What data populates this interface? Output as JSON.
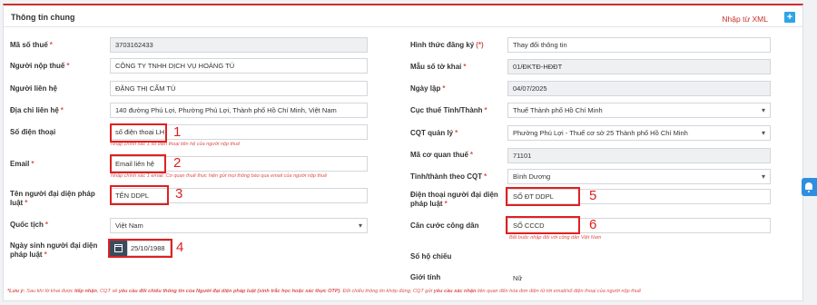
{
  "panel": {
    "title": "Thông tin chung",
    "import_label": "Nhập từ XML",
    "import_icon": "+"
  },
  "left": {
    "tax_code": {
      "label": "Mã số thuế",
      "value": "3703162433"
    },
    "taxpayer": {
      "label": "Người nộp thuế",
      "value": "CÔNG TY TNHH DỊCH VỤ HOÀNG TÚ"
    },
    "contact_person": {
      "label": "Người liên hệ",
      "value": "ĐẶNG THỊ CẨM TÚ"
    },
    "contact_address": {
      "label": "Địa chỉ liên hệ",
      "value": "140 đường Phú Lợi, Phường Phú Lợi, Thành phố Hồ Chí Minh, Việt Nam"
    },
    "phone": {
      "label": "Số điện thoại",
      "value": "số điện thoại LH",
      "hint": "Nhập chính xác 1 số điện thoại liên hệ của người nộp thuế",
      "marker": "1"
    },
    "email": {
      "label": "Email",
      "value": "Email liên hệ",
      "hint": "Nhập chính xác 1 email. Cơ quan thuế thực hiện gửi mọi thông báo qua email của người nộp thuế",
      "marker": "2"
    },
    "legal_rep": {
      "label_line1": "Tên người đại diện pháp",
      "label_line2": "luật",
      "value": "TÊN DDPL",
      "marker": "3"
    },
    "nationality": {
      "label": "Quốc tịch",
      "value": "Việt Nam"
    },
    "birthdate": {
      "label_line1": "Ngày sinh người đại diện",
      "label_line2": "pháp luật",
      "value": "25/10/1988",
      "marker": "4"
    }
  },
  "right": {
    "reg_form": {
      "label": "Hình thức đăng ký",
      "value": "Thay đổi thông tin"
    },
    "declaration_form": {
      "label": "Mẫu số tờ khai",
      "value": "01/ĐKTĐ-HĐĐT"
    },
    "created_date": {
      "label": "Ngày lập",
      "value": "04/07/2025"
    },
    "tax_department": {
      "label": "Cục thuế Tỉnh/Thành",
      "value": "Thuế Thành phố Hồ Chí Minh"
    },
    "managing_authority": {
      "label": "CQT quản lý",
      "value": "Phường Phú Lợi - Thuế cơ sở 25 Thành phố Hồ Chí Minh"
    },
    "authority_code": {
      "label": "Mã cơ quan thuế",
      "value": "71101"
    },
    "province": {
      "label": "Tỉnh/thành theo CQT",
      "value": "Bình Dương"
    },
    "rep_phone": {
      "label_line1": "Điện thoại người đại diện",
      "label_line2": "pháp luật",
      "value": "SỐ ĐT DDPL",
      "marker": "5"
    },
    "id_card": {
      "label": "Căn cước công dân",
      "value": "SỐ CCCD",
      "hint": "Bắt buộc nhập đối với công dân Việt Nam",
      "marker": "6"
    },
    "passport": {
      "label": "Số hộ chiếu",
      "value": ""
    },
    "gender": {
      "label": "Giới tính",
      "value": "Nữ"
    }
  },
  "note": {
    "prefix": "*Lưu ý:",
    "text1": " Sau khi tờ khai được ",
    "bold1": "tiếp nhận",
    "text2": ", CQT sẽ ",
    "bold2": "yêu cầu đổi chiếu thông tin của Người đại diện pháp luật (sinh trắc học hoặc xác thực OTP)",
    "text3": ". Đối chiếu thông tin khớp đúng, CQT gửi ",
    "bold3": "yêu cầu xác nhận",
    "text4": " liên quan đến hóa đơn điện tử tới email/số điện thoại của người nộp thuế"
  },
  "required_mark": "*",
  "required_mark_paren": "(*)",
  "colors": {
    "accent": "#c9302c",
    "highlight": "#e02020",
    "hint": "#d9534f",
    "import_button": "#2fa4e7"
  }
}
